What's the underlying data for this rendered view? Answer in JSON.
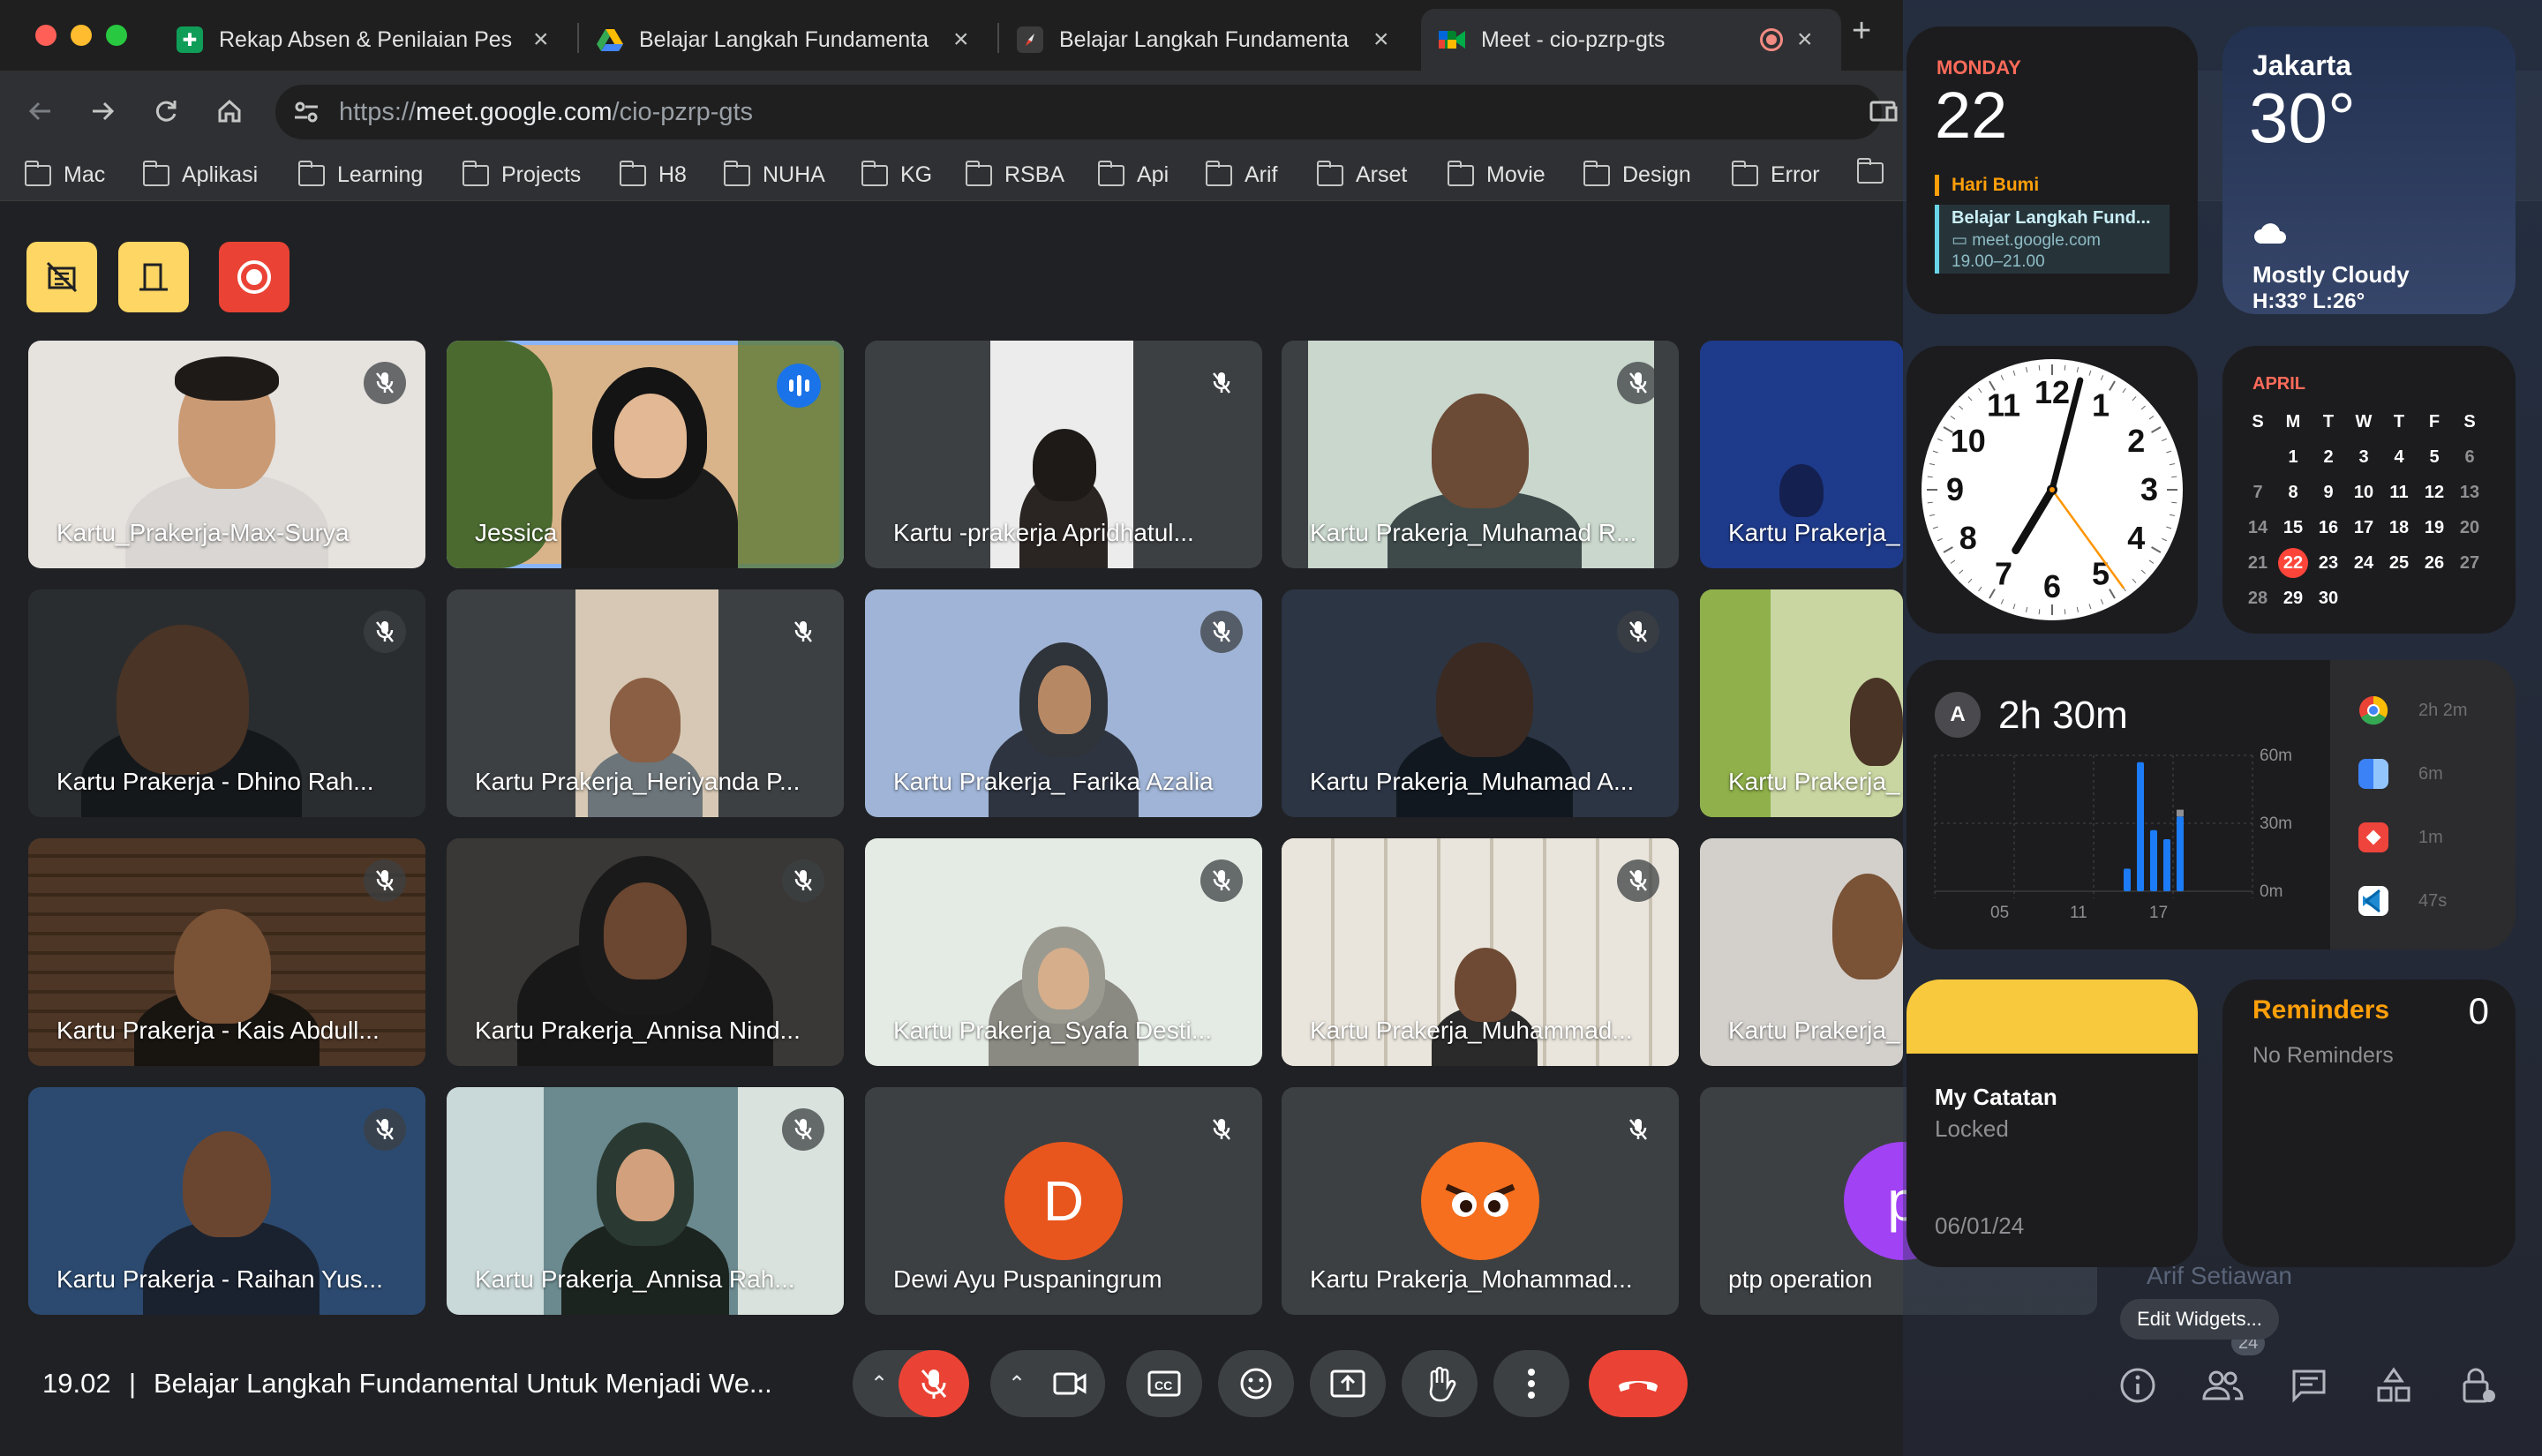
{
  "tabs": [
    {
      "title": "Rekap Absen & Penilaian Pes",
      "icon": "sheets-icon"
    },
    {
      "title": "Belajar Langkah Fundamenta",
      "icon": "drive-icon"
    },
    {
      "title": "Belajar Langkah Fundamenta",
      "icon": "compass-icon"
    },
    {
      "title": "Meet - cio-pzrp-gts",
      "icon": "meet-icon"
    }
  ],
  "address": {
    "prefix": "https://",
    "host": "meet.google.com",
    "path": "/cio-pzrp-gts"
  },
  "bookmarks": [
    "Mac",
    "Aplikasi",
    "Learning",
    "Projects",
    "H8",
    "NUHA",
    "KG",
    "RSBA",
    "Api",
    "Arif",
    "Arset",
    "Movie",
    "Design",
    "Error"
  ],
  "participants": [
    {
      "name": "Kartu_Prakerja-Max-Surya",
      "scene": "room-light",
      "muted": true
    },
    {
      "name": "Jessica",
      "scene": "plants",
      "muted": false,
      "speaking": true
    },
    {
      "name": "Kartu -prakerja Apridhatul...",
      "scene": "portrait-white",
      "muted": true
    },
    {
      "name": "Kartu Prakerja_Muhamad R...",
      "scene": "wall-green",
      "muted": true
    },
    {
      "name": "Kartu Prakerja_",
      "scene": "blue-dark",
      "muted": true
    },
    {
      "name": "Kartu Prakerja - Dhino Rah...",
      "scene": "dark",
      "muted": true
    },
    {
      "name": "Kartu Prakerja_Heriyanda P...",
      "scene": "portrait-warm",
      "muted": true
    },
    {
      "name": "Kartu Prakerja_ Farika Azalia",
      "scene": "blue-light",
      "muted": true
    },
    {
      "name": "Kartu Prakerja_Muhamad A...",
      "scene": "dark-blue",
      "muted": true
    },
    {
      "name": "Kartu Prakerja_",
      "scene": "green-curtain",
      "muted": true
    },
    {
      "name": "Kartu Prakerja - Kais Abdull...",
      "scene": "wood",
      "muted": true
    },
    {
      "name": "Kartu Prakerja_Annisa Nind...",
      "scene": "dim",
      "muted": true
    },
    {
      "name": "Kartu Prakerja_Syafa Desti...",
      "scene": "bright",
      "muted": true
    },
    {
      "name": "Kartu Prakerja_Muhammad...",
      "scene": "shelves",
      "muted": true
    },
    {
      "name": "Kartu Prakerja_",
      "scene": "light-grey",
      "muted": false
    },
    {
      "name": "Kartu Prakerja - Raihan Yus...",
      "scene": "blue-room",
      "muted": true
    },
    {
      "name": "Kartu Prakerja_Annisa Rah...",
      "scene": "office",
      "muted": true
    },
    {
      "name": "Dewi Ayu Puspaningrum",
      "scene": "avatar",
      "avatar_letter": "D",
      "avatar_color": "#e8561e",
      "muted": true
    },
    {
      "name": "Kartu Prakerja_Mohammad...",
      "scene": "avatar-angry",
      "avatar_color": "#f56f1e",
      "muted": true
    },
    {
      "name": "ptp operation",
      "scene": "avatar",
      "avatar_letter": "p",
      "avatar_color": "#a142f4",
      "muted": false
    }
  ],
  "bottom_bar": {
    "time": "19.02",
    "separator": "|",
    "meeting_title": "Belajar Langkah Fundamental Untuk Menjadi We...",
    "participant_count": "24"
  },
  "widgets": {
    "calendar": {
      "day": "MONDAY",
      "date": "22",
      "event_allday": "Hari Bumi",
      "event_title": "Belajar Langkah Fund...",
      "event_location": "meet.google.com",
      "event_time": "19.00–21.00"
    },
    "weather": {
      "city": "Jakarta",
      "temp": "30°",
      "condition": "Mostly Cloudy",
      "range": "H:33° L:26°"
    },
    "clock": {
      "hour": 7,
      "minute": 2,
      "second": 24,
      "numbers": [
        "12",
        "1",
        "2",
        "3",
        "4",
        "5",
        "6",
        "7",
        "8",
        "9",
        "10",
        "11"
      ]
    },
    "month": {
      "name": "APRIL",
      "weekdays": [
        "S",
        "M",
        "T",
        "W",
        "T",
        "F",
        "S"
      ],
      "weeks": [
        [
          "",
          "1",
          "2",
          "3",
          "4",
          "5",
          "6"
        ],
        [
          "7",
          "8",
          "9",
          "10",
          "11",
          "12",
          "13"
        ],
        [
          "14",
          "15",
          "16",
          "17",
          "18",
          "19",
          "20"
        ],
        [
          "21",
          "22",
          "23",
          "24",
          "25",
          "26",
          "27"
        ],
        [
          "28",
          "29",
          "30",
          "",
          "",
          "",
          ""
        ]
      ],
      "today": "22"
    },
    "screen_time": {
      "badge": "A",
      "total": "2h 30m",
      "y_labels": [
        "60m",
        "30m",
        "0m"
      ],
      "x_labels": [
        "05",
        "11",
        "17"
      ],
      "apps": [
        {
          "icon": "chrome-icon",
          "time": "2h 2m"
        },
        {
          "icon": "finder-icon",
          "time": "6m"
        },
        {
          "icon": "anydesk-icon",
          "time": "1m"
        },
        {
          "icon": "vscode-icon",
          "time": "47s"
        }
      ]
    },
    "notes": {
      "title": "My Catatan",
      "status": "Locked",
      "date": "06/01/24"
    },
    "reminders": {
      "title": "Reminders",
      "count": "0",
      "empty": "No Reminders"
    },
    "edit_label": "Edit Widgets...",
    "ghost_name": "Arif Setiawan"
  },
  "chart_data": {
    "type": "bar",
    "title": "",
    "xlabel": "",
    "ylabel": "",
    "ylim": [
      0,
      60
    ],
    "x": [
      14,
      15,
      16,
      17,
      18
    ],
    "series": [
      {
        "values": [
          10,
          57,
          27,
          23,
          33
        ]
      },
      {
        "values": [
          0,
          0,
          0,
          0,
          3
        ]
      }
    ]
  }
}
